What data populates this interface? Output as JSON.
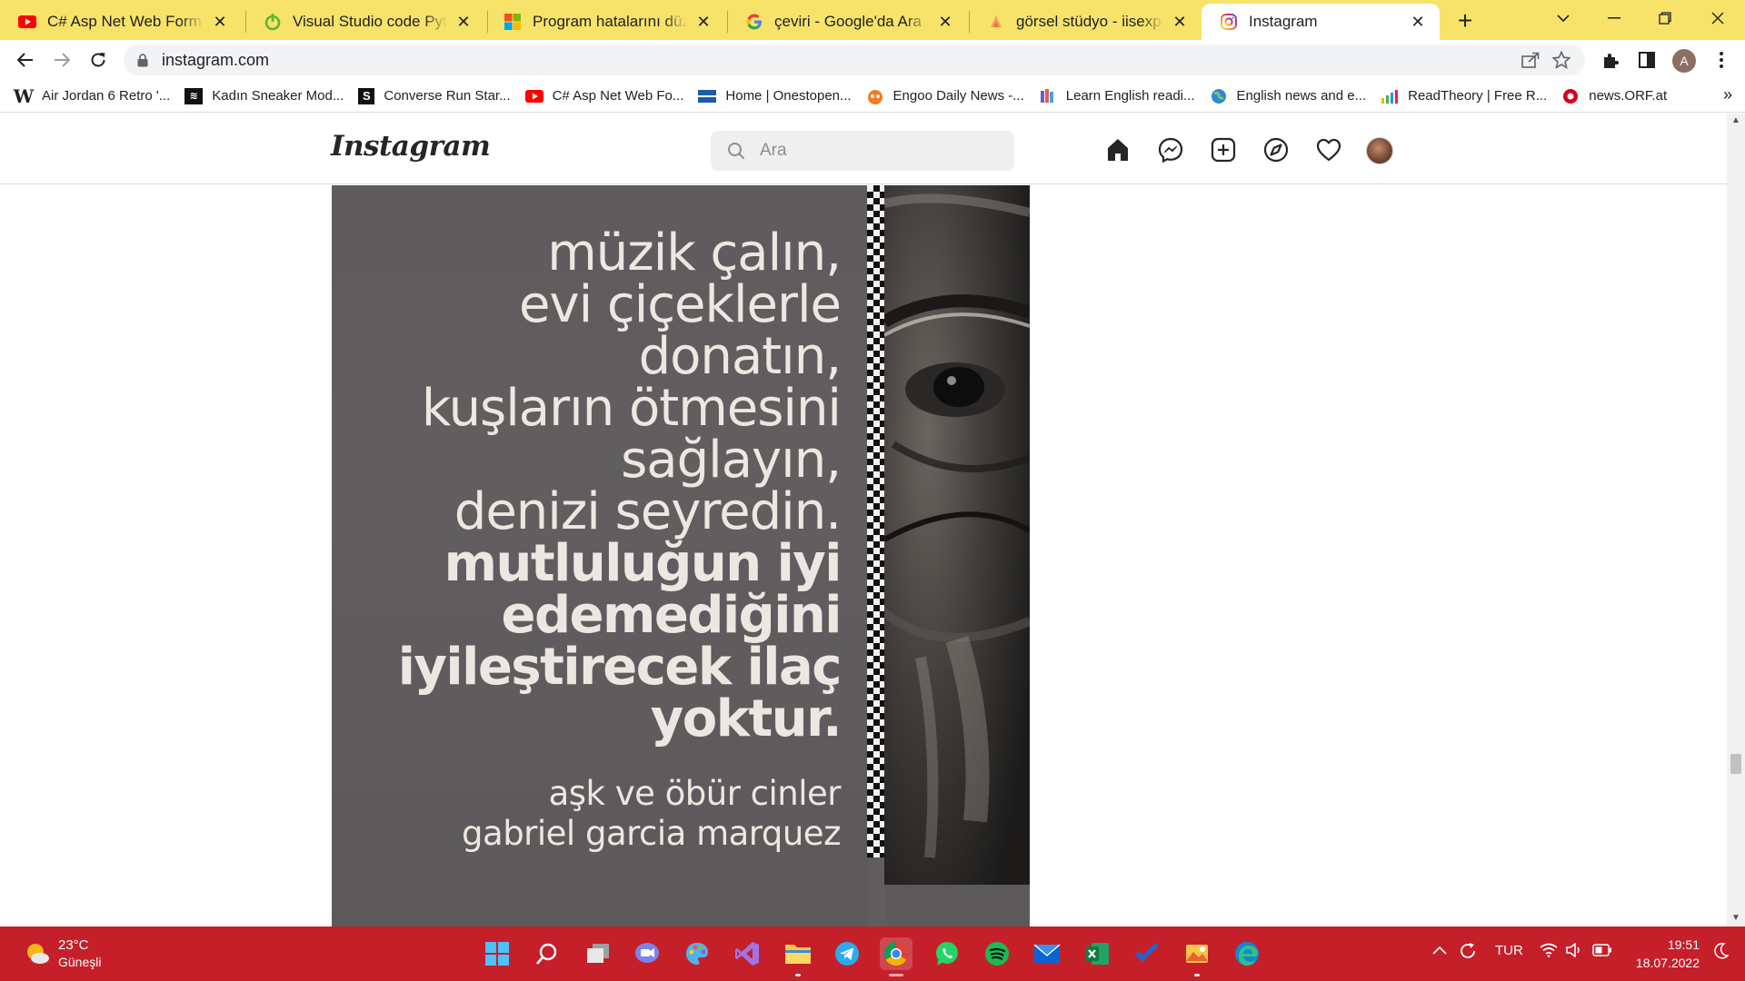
{
  "browser": {
    "tabs": [
      {
        "title": "C# Asp Net Web Form Verit",
        "icon": "youtube-icon"
      },
      {
        "title": "Visual Studio code Python",
        "icon": "power-icon"
      },
      {
        "title": "Program hatalarını düzeltm",
        "icon": "microsoft-icon"
      },
      {
        "title": "çeviri - Google'da Ara",
        "icon": "google-icon"
      },
      {
        "title": "görsel stüdyo - iisexpress.e",
        "icon": "page-icon"
      },
      {
        "title": "Instagram",
        "icon": "instagram-icon",
        "active": true
      }
    ],
    "url": "instagram.com",
    "profile_initial": "A",
    "bookmarks": [
      {
        "label": "Air Jordan 6 Retro '...",
        "icon": "W"
      },
      {
        "label": "Kadın Sneaker Mod...",
        "icon": "S"
      },
      {
        "label": "Converse Run Star...",
        "icon": "S"
      },
      {
        "label": "C# Asp Net Web Fo...",
        "icon": "youtube"
      },
      {
        "label": "Home | Onestopen...",
        "icon": "onestop"
      },
      {
        "label": "Engoo Daily News -...",
        "icon": "engoo"
      },
      {
        "label": "Learn English readi...",
        "icon": "books"
      },
      {
        "label": "English news and e...",
        "icon": "globe"
      },
      {
        "label": "ReadTheory | Free R...",
        "icon": "chart"
      },
      {
        "label": "news.ORF.at",
        "icon": "orf"
      }
    ],
    "bookmarks_overflow": "»"
  },
  "instagram": {
    "logo": "Instagram",
    "search_placeholder": "Ara",
    "nav": [
      "home-icon",
      "messenger-icon",
      "new-post-icon",
      "explore-icon",
      "activity-icon",
      "profile-avatar"
    ]
  },
  "post": {
    "quote_light": [
      "müzik çalın,",
      "evi çiçeklerle donatın,",
      "kuşların ötmesini",
      "sağlayın,",
      "denizi seyredin."
    ],
    "quote_bold": [
      "mutluluğun iyi",
      "edemediğini",
      "iyileştirecek ilaç",
      "yoktur."
    ],
    "book": "aşk ve öbür cinler",
    "author": "gabriel garcia marquez"
  },
  "taskbar": {
    "weather_temp": "23°C",
    "weather_condition": "Güneşli",
    "language": "TUR",
    "time": "19:51",
    "date": "18.07.2022",
    "apps": [
      "start-icon",
      "search-icon",
      "task-view-icon",
      "teams-chat-icon",
      "paint-icon",
      "visual-studio-icon",
      "file-explorer-icon",
      "telegram-icon",
      "chrome-icon",
      "whatsapp-icon",
      "spotify-icon",
      "mail-icon",
      "excel-icon",
      "todo-icon",
      "photos-icon",
      "edge-icon"
    ]
  },
  "colors": {
    "tabstrip": "#f8e36a",
    "taskbar": "#c51f2a",
    "post_bg": "#5f5d5e"
  }
}
